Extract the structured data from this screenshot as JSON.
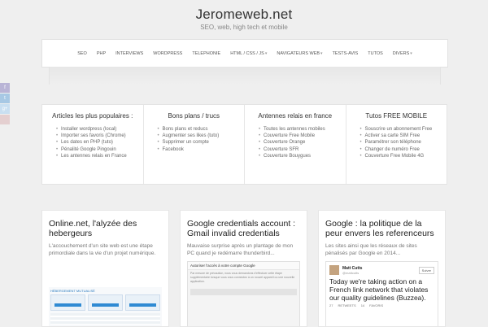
{
  "site": {
    "title": "Jeromeweb.net",
    "tagline": "SEO, web, high tech et mobile"
  },
  "nav": {
    "items": [
      "SEO",
      "PHP",
      "INTERVIEWS",
      "WORDPRESS",
      "TELEPHONIE",
      "HTML / CSS / JS",
      "NAVIGATEURS WEB",
      "TESTS-AVIS",
      "TUTOS",
      "DIVERS"
    ],
    "sub_marker": "▾"
  },
  "social": [
    "f",
    "t",
    "g+",
    ""
  ],
  "widgets": [
    {
      "title": "Articles les plus populaires :",
      "items": [
        "Installer wordpress (local)",
        "Importer ses favoris (Chrome)",
        "Les dates en PHP (tuto)",
        "Pénalité Google Pingouin",
        "Les antennes relais en France"
      ]
    },
    {
      "title": "Bons plans / trucs",
      "items": [
        "Bons plans et reducs",
        "Augmenter ses likes (tuto)",
        "Supprimer un compte",
        "Facebook"
      ]
    },
    {
      "title": "Antennes relais en france",
      "items": [
        "Toutes les antennes mobiles",
        "Couverture Free Mobile",
        "Couverture Orange",
        "Couverture SFR",
        "Couverture Bouygues"
      ]
    },
    {
      "title": "Tutos FREE MOBILE",
      "items": [
        "Souscrire un abonnement Free",
        "Activer sa carte SIM Free",
        "Paramétrer son téléphone",
        "Changer de numéro Free",
        "Couverture Free Mobile 4G"
      ]
    }
  ],
  "posts": [
    {
      "title": "Online.net, l'alyzée des hebergeurs",
      "excerpt": "L'accouchement d'un site web est une étape primordiale dans la vie d'un projet numérique.",
      "thumb_header": "HÉBERGEMENT MUTUALISÉ"
    },
    {
      "title": "Google credentials account : Gmail invalid credentials",
      "excerpt": "Mauvaise surprise après un plantage de mon PC quand je redémarre thunderbird...",
      "thumb_header": "Autoriser l'accès à votre compte Google",
      "thumb_body": "Par mesure de précaution, nous vous demandons d'effectuer cette étape supplémentaire lorsque vous vous connectez à un nouvel appareil ou une nouvelle application."
    },
    {
      "title": "Google : la politique de la peur envers les referenceurs",
      "excerpt": "Les sites ainsi que les réseaux de sites pénalisés par Google en 2014...",
      "tweet": {
        "name": "Matt Cutts",
        "handle": "@mattcutts",
        "follow": "Suivre",
        "text": "Today we're taking action on a French link network that violates our quality guidelines (Buzzea).",
        "retweets": "RETWEETS",
        "favorites": "FAVORIS",
        "rt_count": "27",
        "fav_count": "14"
      }
    }
  ]
}
